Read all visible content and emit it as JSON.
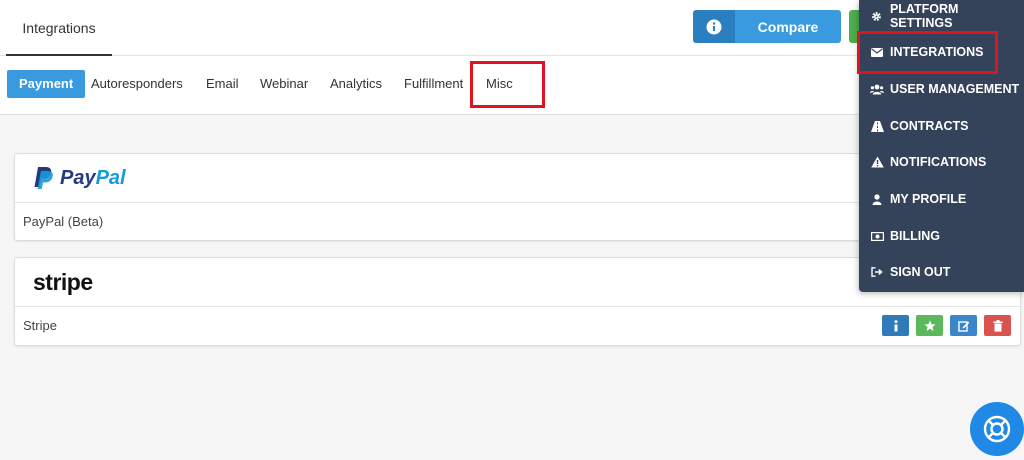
{
  "header": {
    "title": "Integrations",
    "compare_label": "Compare"
  },
  "tabs": [
    {
      "label": "Payment",
      "active": true
    },
    {
      "label": "Autoresponders"
    },
    {
      "label": "Email"
    },
    {
      "label": "Webinar"
    },
    {
      "label": "Analytics"
    },
    {
      "label": "Fulfillment"
    },
    {
      "label": "Misc"
    }
  ],
  "integrations": [
    {
      "logo_pay": "Pay",
      "logo_pal": "Pal",
      "name": "PayPal (Beta)"
    },
    {
      "logo_text": "stripe",
      "name": "Stripe"
    }
  ],
  "menu": {
    "items": [
      {
        "label": "PLATFORM SETTINGS",
        "icon": "gear-icon"
      },
      {
        "label": "INTEGRATIONS",
        "icon": "envelope-icon"
      },
      {
        "label": "USER MANAGEMENT",
        "icon": "users-icon"
      },
      {
        "label": "CONTRACTS",
        "icon": "road-icon"
      },
      {
        "label": "NOTIFICATIONS",
        "icon": "warning-icon"
      },
      {
        "label": "MY PROFILE",
        "icon": "user-icon"
      },
      {
        "label": "BILLING",
        "icon": "money-icon"
      },
      {
        "label": "SIGN OUT",
        "icon": "sign-out-icon"
      }
    ]
  },
  "colors": {
    "accent": "#3a9ae0",
    "menu_bg": "#34425a",
    "highlight": "#e0141e",
    "success": "#5cb85c",
    "danger": "#d9534f"
  }
}
